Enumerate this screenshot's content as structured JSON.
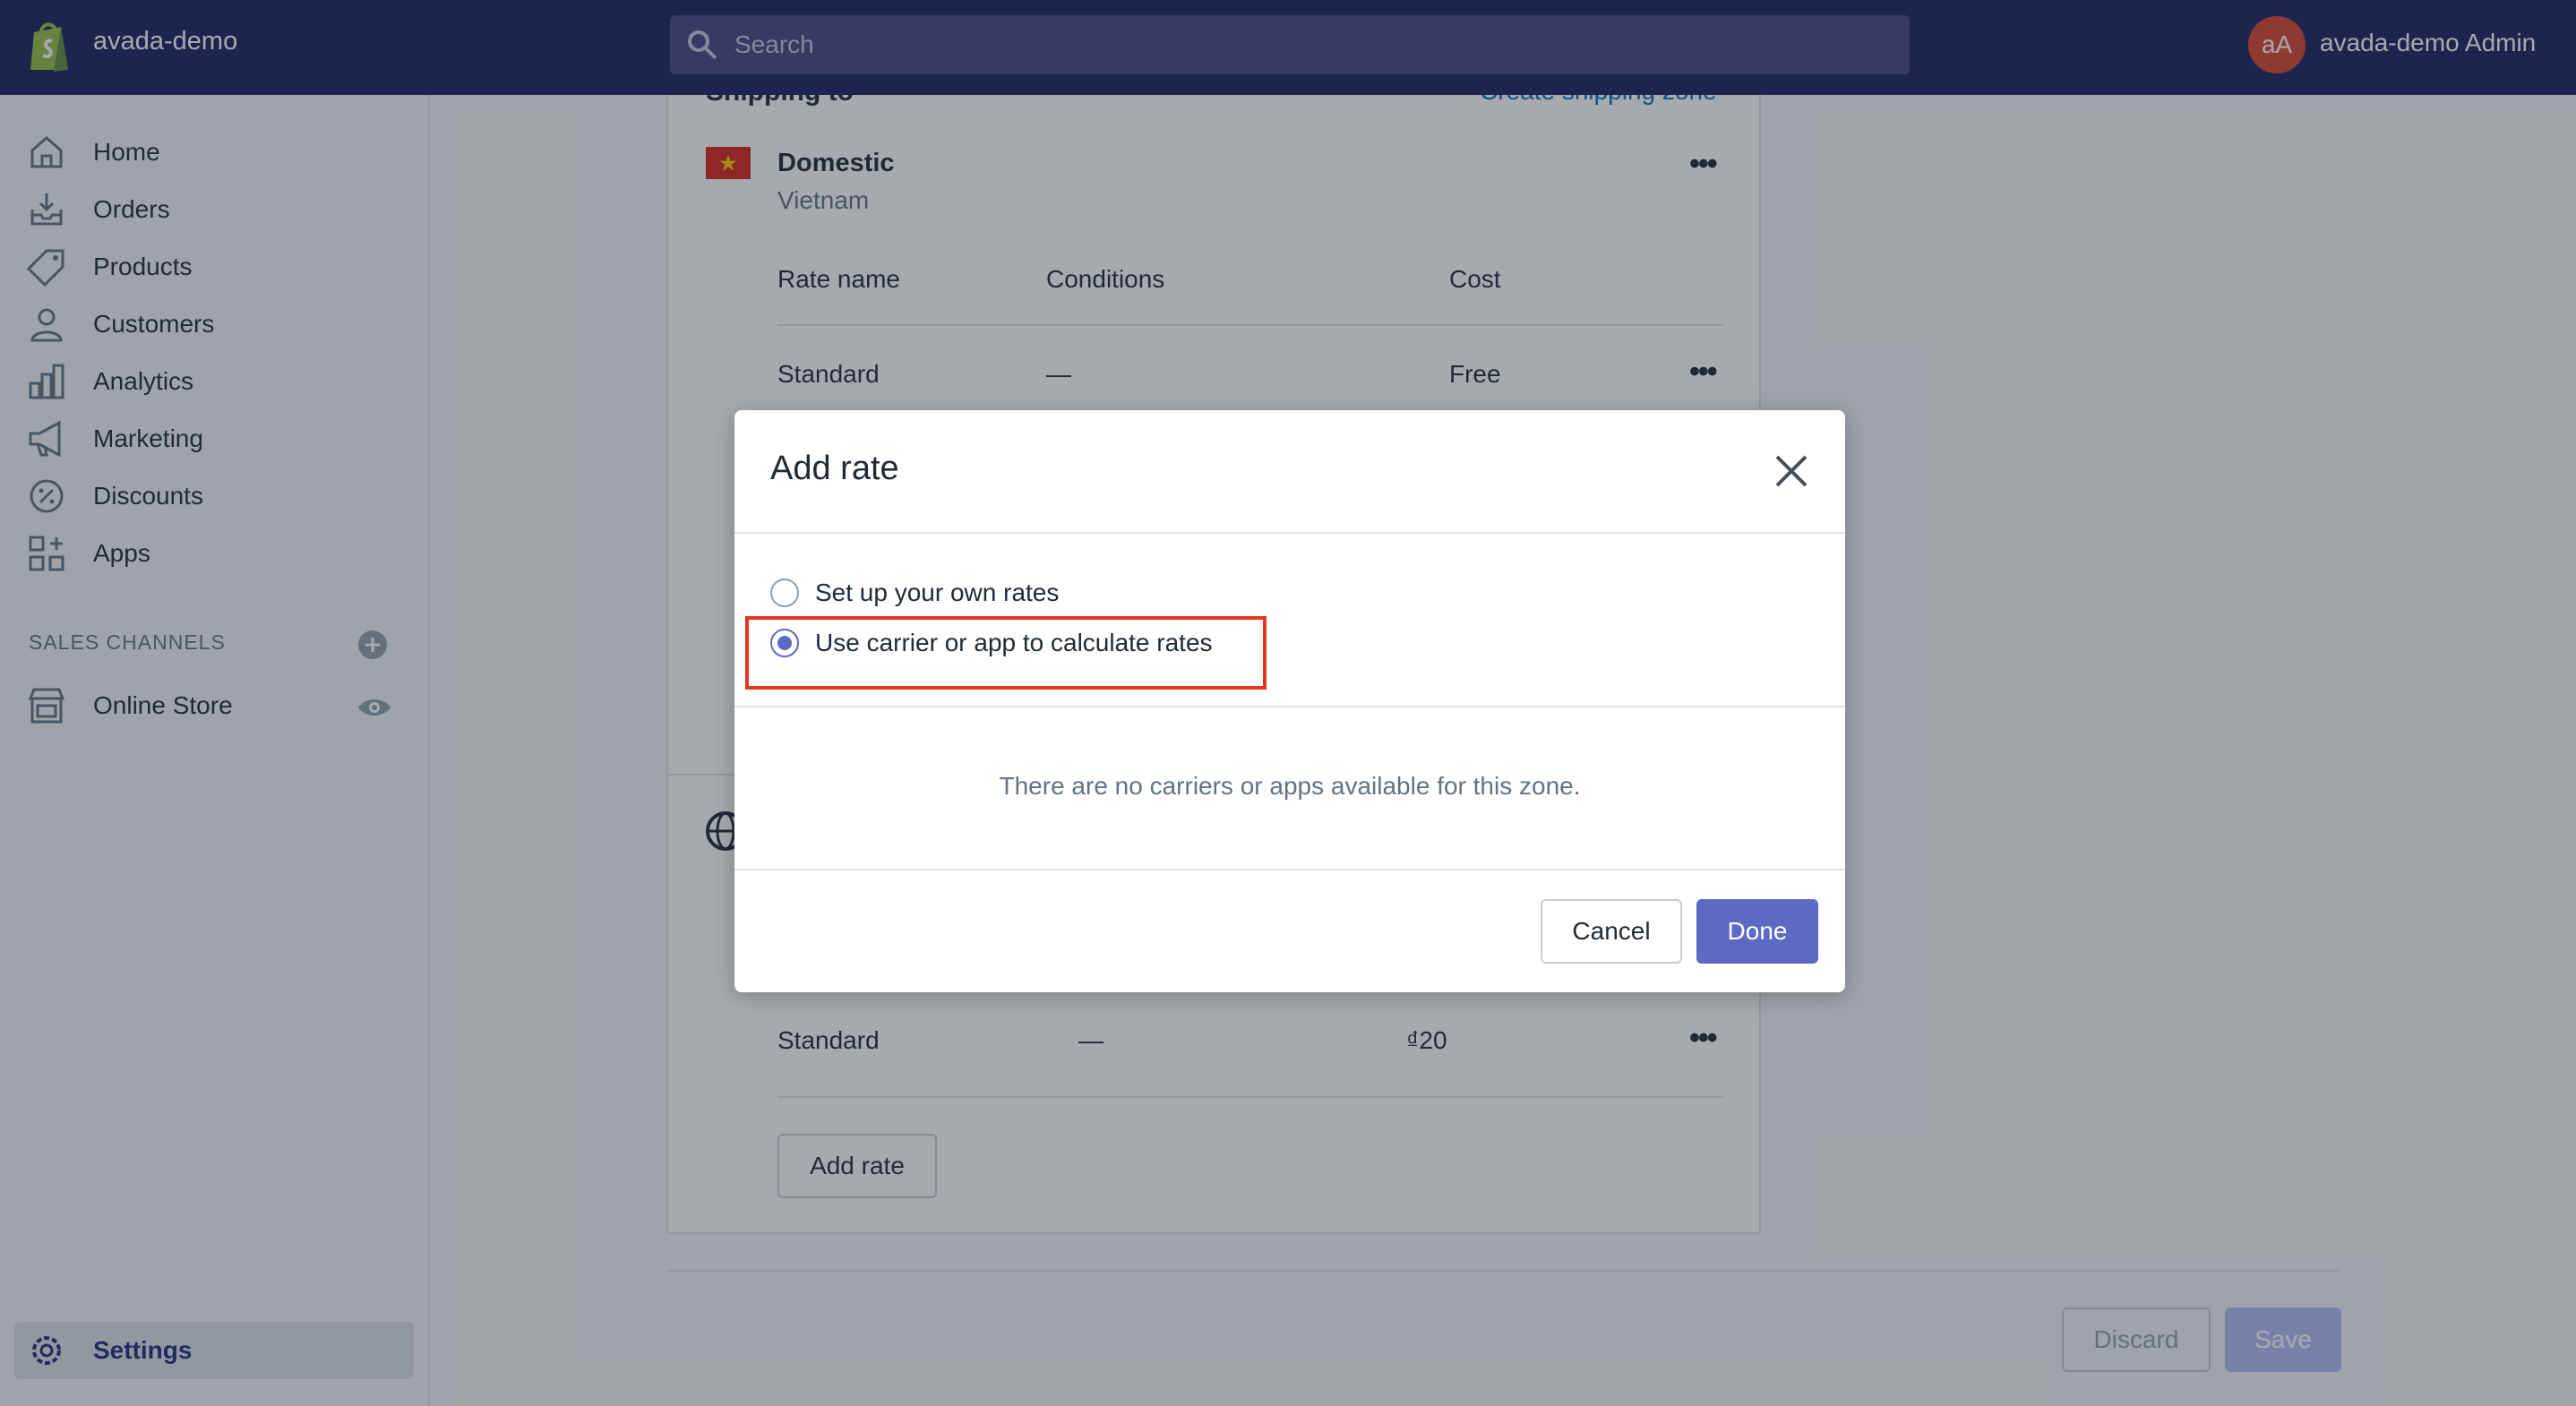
{
  "topbar": {
    "store_name": "avada-demo",
    "search_placeholder": "Search",
    "avatar_initials": "aA",
    "admin_name": "avada-demo Admin"
  },
  "sidebar": {
    "items": [
      {
        "label": "Home",
        "icon": "home-icon"
      },
      {
        "label": "Orders",
        "icon": "orders-icon"
      },
      {
        "label": "Products",
        "icon": "tag-icon"
      },
      {
        "label": "Customers",
        "icon": "person-icon"
      },
      {
        "label": "Analytics",
        "icon": "bar-chart-icon"
      },
      {
        "label": "Marketing",
        "icon": "megaphone-icon"
      },
      {
        "label": "Discounts",
        "icon": "discount-icon"
      },
      {
        "label": "Apps",
        "icon": "apps-icon"
      }
    ],
    "sales_channels_title": "SALES CHANNELS",
    "online_store_label": "Online Store",
    "settings_label": "Settings"
  },
  "card": {
    "title": "Shipping to",
    "link": "Create shipping zone",
    "zone_title": "Domestic",
    "zone_country": "Vietnam",
    "columns": [
      "Rate name",
      "Conditions",
      "Cost"
    ],
    "rows": [
      {
        "name": "Standard",
        "conditions": "—",
        "cost": "Free"
      },
      {
        "name": "Standard",
        "conditions": "—",
        "cost": "₫20"
      }
    ],
    "add_rate_label": "Add rate",
    "more_glyph": "•••"
  },
  "footer": {
    "discard_label": "Discard",
    "save_label": "Save"
  },
  "modal": {
    "title": "Add rate",
    "option_own": "Set up your own rates",
    "option_carrier": "Use carrier or app to calculate rates",
    "empty_message": "There are no carriers or apps available for this zone.",
    "cancel_label": "Cancel",
    "done_label": "Done"
  },
  "colors": {
    "topbar": "#1c2260",
    "primary": "#5c6ac4",
    "highlight": "#e8341f",
    "avatar": "#d8432f"
  }
}
